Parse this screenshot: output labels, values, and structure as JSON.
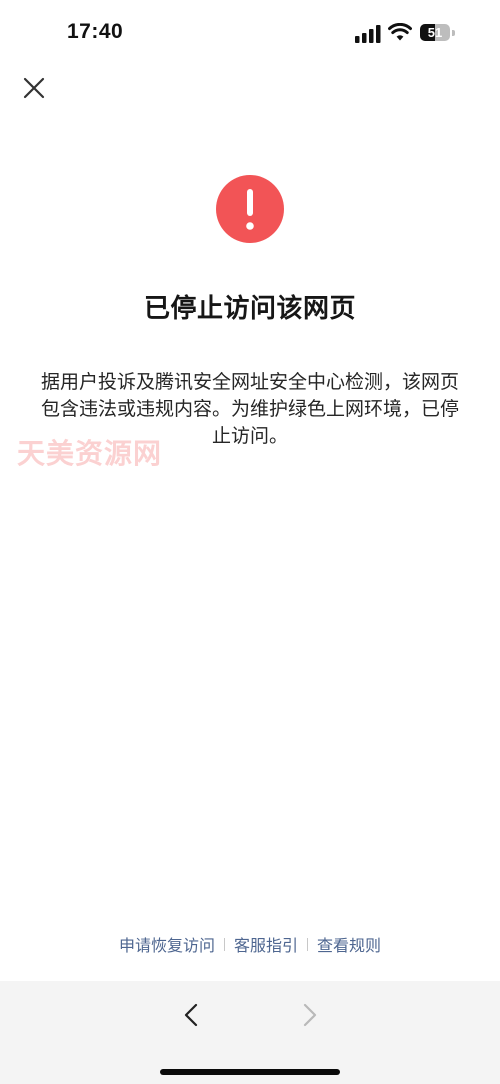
{
  "status_bar": {
    "time": "17:40",
    "battery_level": "51",
    "battery_fraction": 0.51,
    "icons": [
      "signal-icon",
      "wifi-icon",
      "battery-icon"
    ]
  },
  "header": {
    "close_icon": "close-icon"
  },
  "alert": {
    "icon": "exclamation-icon",
    "color": "#f25456",
    "title": "已停止访问该网页",
    "message": "据用户投诉及腾讯安全网址安全中心检测，该网页包含违法或违规内容。为维护绿色上网环境，已停止访问。"
  },
  "watermark": {
    "text": "天美资源网"
  },
  "footer": {
    "links": [
      "申请恢复访问",
      "客服指引",
      "查看规则"
    ],
    "link_color": "#4e6690"
  },
  "nav_bar": {
    "back_icon": "chevron-left-icon",
    "forward_icon": "chevron-right-icon"
  }
}
